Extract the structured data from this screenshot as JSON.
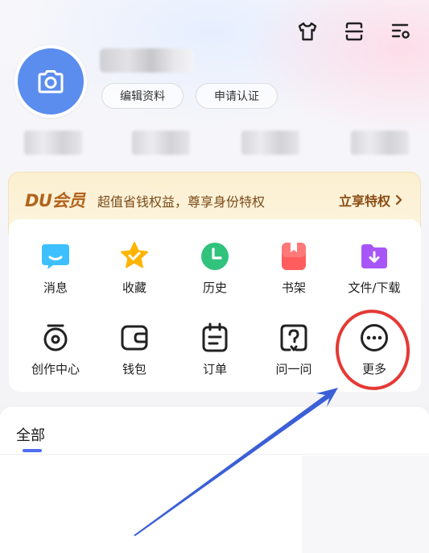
{
  "profile": {
    "edit_label": "编辑资料",
    "certify_label": "申请认证"
  },
  "vip": {
    "logo": "DU会员",
    "slogan": "超值省钱权益，尊享身份特权",
    "cta": "立享特权"
  },
  "menu": {
    "row1": [
      {
        "label": "消息",
        "icon": "message-icon",
        "color": "#3ec0ff"
      },
      {
        "label": "收藏",
        "icon": "star-icon",
        "color": "#ffb400"
      },
      {
        "label": "历史",
        "icon": "clock-icon",
        "color": "#31c27c"
      },
      {
        "label": "书架",
        "icon": "bookshelf-icon",
        "color": "#ff5d5d"
      },
      {
        "label": "文件/下载",
        "icon": "download-folder-icon",
        "color": "#a855f7"
      }
    ],
    "row2": [
      {
        "label": "创作中心",
        "icon": "creation-center-icon"
      },
      {
        "label": "钱包",
        "icon": "wallet-icon"
      },
      {
        "label": "订单",
        "icon": "order-icon"
      },
      {
        "label": "问一问",
        "icon": "question-icon"
      },
      {
        "label": "更多",
        "icon": "more-icon"
      }
    ]
  },
  "tabs": {
    "all": "全部"
  },
  "colors": {
    "avatar": "#5b8def",
    "accent": "#4e6ef2",
    "annotation_circle": "#e53935",
    "annotation_arrow": "#3b5fd6"
  }
}
